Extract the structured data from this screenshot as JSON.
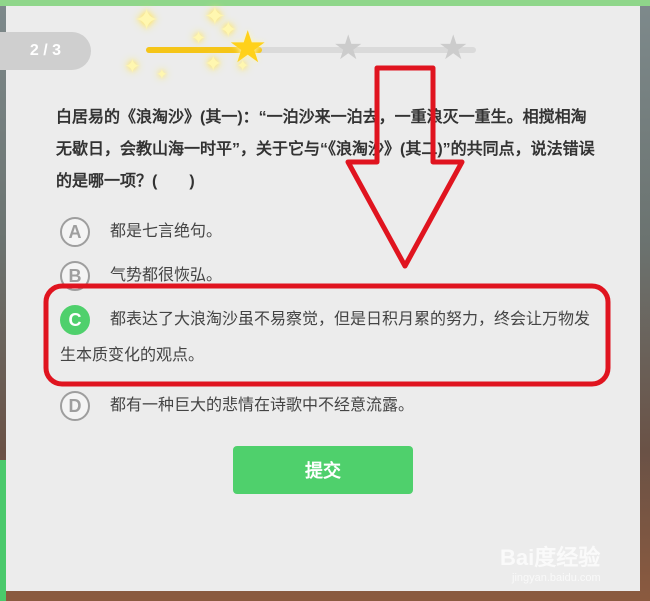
{
  "quiz": {
    "pager": "2 / 3",
    "progress_fraction": 0.35,
    "question": "白居易的《浪淘沙》(其一)：“一泊沙来一泊去，一重浪灭一重生。相搅相淘无歇日，会教山海一时平”，关于它与“《浪淘沙》(其二)”的共同点，说法错误的是哪一项？(　　)",
    "options": [
      {
        "letter": "A",
        "text": "都是七言绝句。"
      },
      {
        "letter": "B",
        "text": "气势都很恢弘。"
      },
      {
        "letter": "C",
        "text": "都表达了大浪淘沙虽不易察觉，但是日积月累的努力，终会让万物发生本质变化的观点。",
        "selected": true
      },
      {
        "letter": "D",
        "text": "都有一种巨大的悲情在诗歌中不经意流露。"
      }
    ],
    "submit_label": "提交"
  },
  "colors": {
    "accent_green": "#4fd06c",
    "star_gold": "#ffd11a",
    "annotation_red": "#e0141f"
  },
  "icons": [
    "star-gold-icon",
    "star-grey-icon",
    "sparkle-icon",
    "arrow-down-annotation"
  ],
  "watermark": {
    "main": "Bai度经验",
    "sub": "jingyan.baidu.com"
  }
}
